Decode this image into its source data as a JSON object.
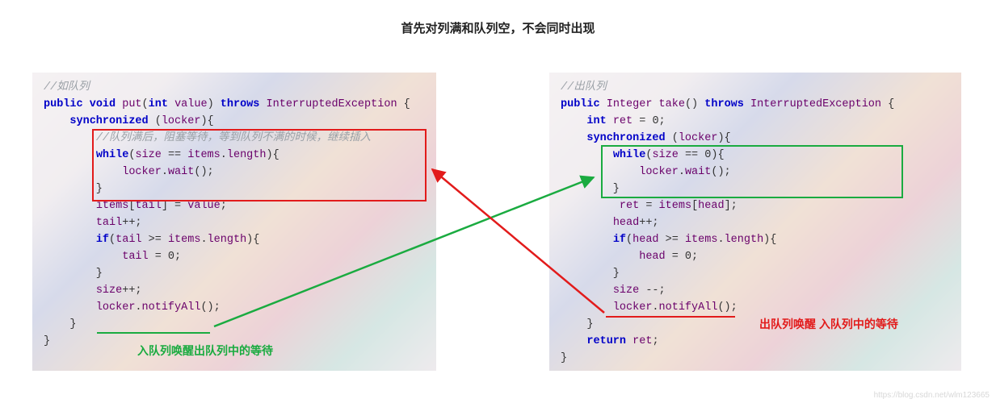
{
  "title": "首先对列满和队列空，不会同时出现",
  "left": {
    "comment_top": "//如队列",
    "l1a": "public",
    "l1b": "void",
    "l1c": "put",
    "l1d": "int",
    "l1e": "value",
    "l1f": "throws",
    "l1g": "InterruptedException",
    "l2a": "synchronized",
    "l2b": "locker",
    "comment_inner": "//队列满后，阻塞等待，等到队列不满的时候，继续插入",
    "l3a": "while",
    "l3b": "size",
    "l3c": "items",
    "l3d": "length",
    "l4a": "locker",
    "l4b": "wait",
    "l5a": "items",
    "l5b": "tail",
    "l5c": "value",
    "l6a": "tail",
    "l7a": "if",
    "l7b": "tail",
    "l7c": "items",
    "l7d": "length",
    "l8a": "tail",
    "l9a": "size",
    "l10a": "locker",
    "l10b": "notifyAll",
    "caption": "入队列唤醒出队列中的等待"
  },
  "right": {
    "comment_top": "//出队列",
    "l1a": "public",
    "l1b": "Integer",
    "l1c": "take",
    "l1d": "throws",
    "l1e": "InterruptedException",
    "l2a": "int",
    "l2b": "ret",
    "l3a": "synchronized",
    "l3b": "locker",
    "l4a": "while",
    "l4b": "size",
    "l5a": "locker",
    "l5b": "wait",
    "l6a": "ret",
    "l6b": "items",
    "l6c": "head",
    "l7a": "head",
    "l8a": "if",
    "l8b": "head",
    "l8c": "items",
    "l8d": "length",
    "l9a": "head",
    "l10a": "size",
    "l11a": "locker",
    "l11b": "notifyAll",
    "l12a": "return",
    "l12b": "ret",
    "caption": "出队列唤醒 入队列中的等待"
  },
  "watermark": "https://blog.csdn.net/wlm123665"
}
